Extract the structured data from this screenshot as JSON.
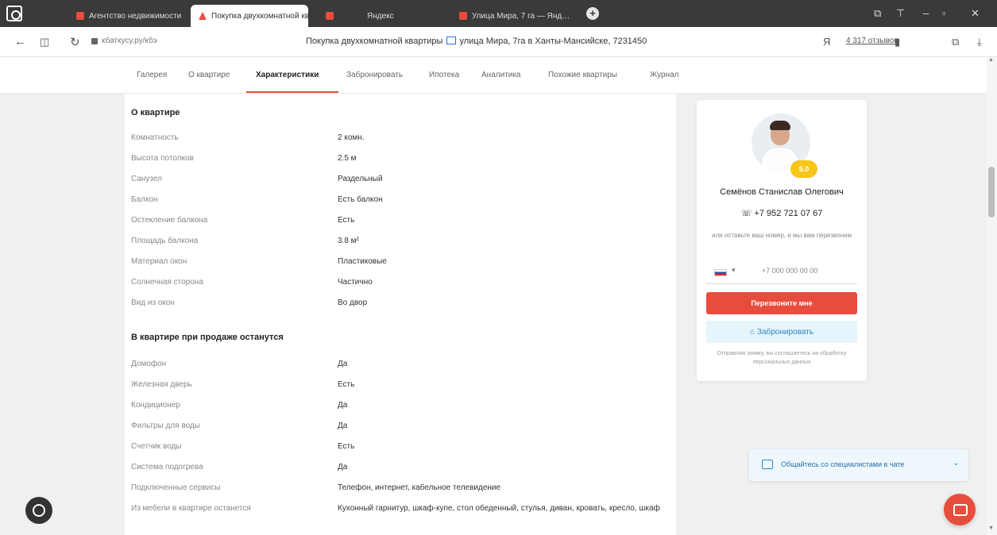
{
  "browser": {
    "tabs": [
      {
        "label": "Агентство недвижимости",
        "active": false,
        "color": "#e84c3d"
      },
      {
        "label": "Покупка двухкомнатной квартиры",
        "active": true,
        "color": "#e84c3d"
      },
      {
        "label": "Яндекс",
        "active": false,
        "color": "#e84c3d"
      },
      {
        "label": "Улица Мира, 7 га — Янд…",
        "active": false,
        "color": "#e84c3d"
      }
    ],
    "url": "кбаткусу.ру/кбэ",
    "page_title": "Покупка двухкомнатной квартиры",
    "page_title_rest": "улица Мира, 7га в Ханты-Мансийске, 7231450",
    "reviews_label": "4 317 отзывов"
  },
  "sitenav": {
    "items": [
      "Галерея",
      "О квартире",
      "Характеристики",
      "Забронировать",
      "Ипотека",
      "Аналитика",
      "Похожие квартиры",
      "Журнал"
    ],
    "active_index": 2
  },
  "about": {
    "title": "О квартире",
    "rows": [
      {
        "label": "Комнатность",
        "value": "2 комн."
      },
      {
        "label": "Высота потолков",
        "value": "2.5 м"
      },
      {
        "label": "Санузел",
        "value": "Раздельный"
      },
      {
        "label": "Балкон",
        "value": "Есть балкон"
      },
      {
        "label": "Остекление балкона",
        "value": "Есть"
      },
      {
        "label": "Площадь балкона",
        "value": "3.8 м²"
      },
      {
        "label": "Материал окон",
        "value": "Пластиковые"
      },
      {
        "label": "Солнечная сторона",
        "value": "Частично"
      },
      {
        "label": "Вид из окон",
        "value": "Во двор"
      }
    ]
  },
  "leftover": {
    "title": "В квартире при продаже останутся",
    "rows": [
      {
        "label": "Домофон",
        "value": "Да"
      },
      {
        "label": "Железная дверь",
        "value": "Есть"
      },
      {
        "label": "Кондиционер",
        "value": "Да"
      },
      {
        "label": "Фильтры для воды",
        "value": "Да"
      },
      {
        "label": "Счетчик воды",
        "value": "Есть"
      },
      {
        "label": "Система подогрева",
        "value": "Да"
      },
      {
        "label": "Подключенные сервисы",
        "value": "Телефон, интернет, кабельное телевидение"
      },
      {
        "label": "Из мебели в квартире останется",
        "value": "Кухонный гарнитур, шкаф-купе, стол обеденный, стулья, диван, кровать, кресло, шкаф"
      }
    ]
  },
  "agent": {
    "name": "Семёнов Станислав Олегович",
    "phone": "+7 952 721 07 67",
    "badge": "5.0",
    "note": "или оставьте ваш номер, и мы вам перезвоним",
    "phone_placeholder": "+7 000 000 00 00",
    "call_button": "Перезвоните мне",
    "book_button": "Забронировать",
    "footer": "Отправляя заявку, вы соглашаетесь на обработку персональных данных",
    "accent": "#e84c3d"
  },
  "chat": {
    "label": "Общайтесь со специалистами в чате"
  }
}
